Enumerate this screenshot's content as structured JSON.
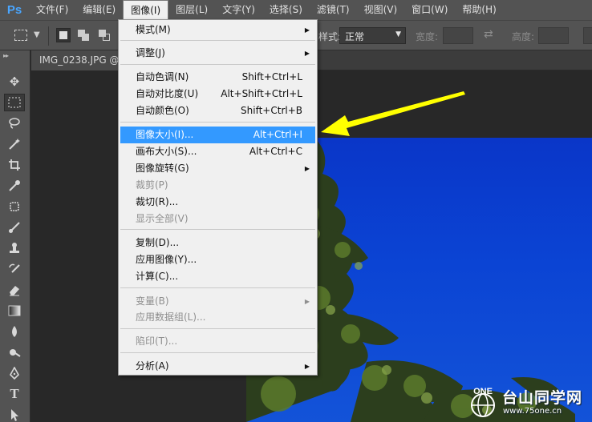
{
  "menubar": {
    "logo": "Ps",
    "items": [
      "文件(F)",
      "编辑(E)",
      "图像(I)",
      "图层(L)",
      "文字(Y)",
      "选择(S)",
      "滤镜(T)",
      "视图(V)",
      "窗口(W)",
      "帮助(H)"
    ],
    "open_index": 2
  },
  "options": {
    "style_label": "样式:",
    "style_value": "正常",
    "width_label": "宽度:",
    "height_label": "高度:"
  },
  "document": {
    "tab_label": "IMG_0238.JPG @ 2"
  },
  "image_menu": {
    "mode": "模式(M)",
    "adjustments": "调整(J)",
    "auto_tone": "自动色调(N)",
    "auto_tone_sc": "Shift+Ctrl+L",
    "auto_contrast": "自动对比度(U)",
    "auto_contrast_sc": "Alt+Shift+Ctrl+L",
    "auto_color": "自动颜色(O)",
    "auto_color_sc": "Shift+Ctrl+B",
    "image_size": "图像大小(I)...",
    "image_size_sc": "Alt+Ctrl+I",
    "canvas_size": "画布大小(S)...",
    "canvas_size_sc": "Alt+Ctrl+C",
    "image_rotation": "图像旋转(G)",
    "crop": "裁剪(P)",
    "trim": "裁切(R)...",
    "reveal_all": "显示全部(V)",
    "duplicate": "复制(D)...",
    "apply_image": "应用图像(Y)...",
    "calculations": "计算(C)...",
    "variables": "变量(B)",
    "apply_data_set": "应用数据组(L)...",
    "trap": "陷印(T)...",
    "analysis": "分析(A)"
  },
  "watermark": {
    "logo_text": "ONE",
    "title": "台山同学网",
    "url": "www.75one.cn"
  },
  "colors": {
    "highlight": "#3399ff",
    "arrow": "#ffff00",
    "sky": "#0b44d4"
  }
}
